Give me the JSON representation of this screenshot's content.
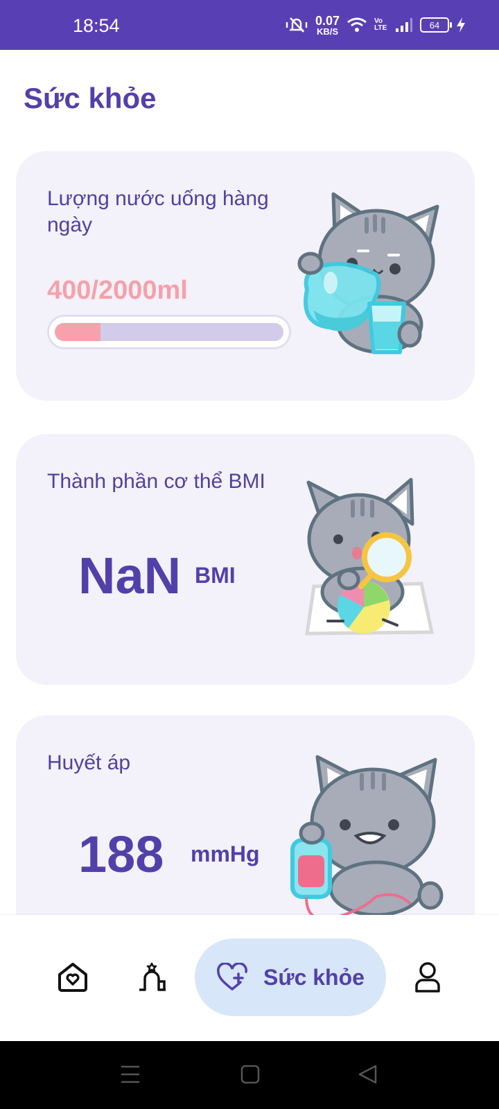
{
  "status_bar": {
    "time": "18:54",
    "net_speed": "0.07",
    "net_unit": "KB/S",
    "volte": "Vo LTE",
    "battery": "64"
  },
  "page": {
    "title": "Sức khỏe"
  },
  "cards": {
    "water": {
      "label": "Lượng nước uống hàng ngày",
      "amount": "400/2000ml",
      "progress": 0.2
    },
    "bmi": {
      "label": "Thành phần cơ thể BMI",
      "value": "NaN",
      "unit": "BMI"
    },
    "blood_pressure": {
      "label": "Huyết áp",
      "value": "188",
      "unit": "mmHg"
    }
  },
  "bottom_nav": {
    "items": [
      {
        "icon": "home-heart-icon"
      },
      {
        "icon": "activity-person-icon"
      },
      {
        "icon": "heart-plus-icon",
        "label": "Sức khỏe",
        "active": true
      },
      {
        "icon": "user-icon"
      }
    ]
  },
  "colors": {
    "status_bar": "#5840B4",
    "accent": "#5240AA",
    "card_bg": "#F3F1FA",
    "water_pink": "#F5A1AA",
    "nav_active_bg": "#D7E6F8"
  }
}
